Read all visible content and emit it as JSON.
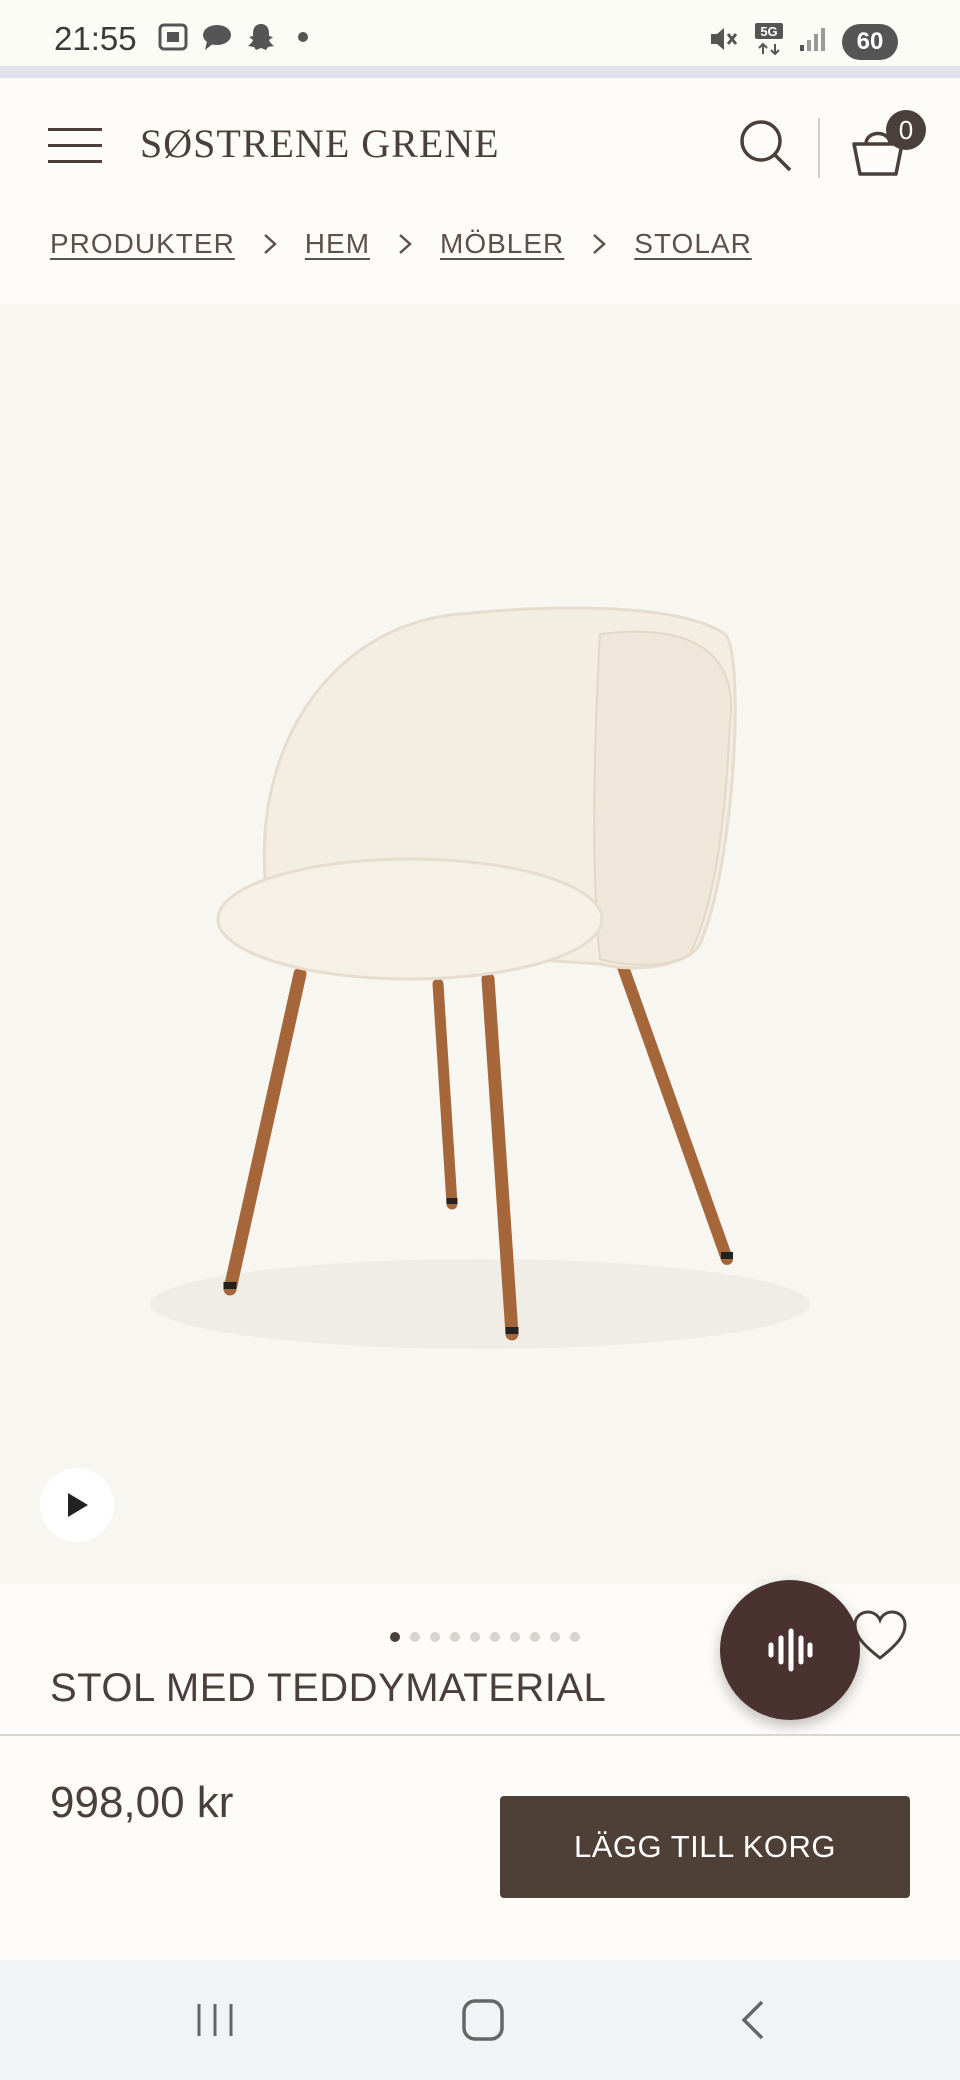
{
  "status_bar": {
    "time": "21:55",
    "battery": "60",
    "network": "5G",
    "icons_left": [
      "screenshot-icon",
      "chat-icon",
      "snapchat-icon"
    ],
    "icons_right": [
      "mute-icon",
      "5g-icon",
      "signal-icon"
    ]
  },
  "header": {
    "logo": "SØSTRENE GRENE",
    "cart_count": "0"
  },
  "breadcrumb": [
    "PRODUKTER",
    "HEM",
    "MÖBLER",
    "STOLAR"
  ],
  "gallery": {
    "total_images": 10,
    "active_index": 0
  },
  "product": {
    "title": "STOL MED TEDDYMATERIAL",
    "price": "998,00 kr",
    "add_to_cart_label": "LÄGG TILL KORG"
  },
  "colors": {
    "brand_dark": "#4e3f37",
    "fab": "#4a3230",
    "background": "#fdfcf8",
    "image_bg": "#f7f6f1"
  }
}
